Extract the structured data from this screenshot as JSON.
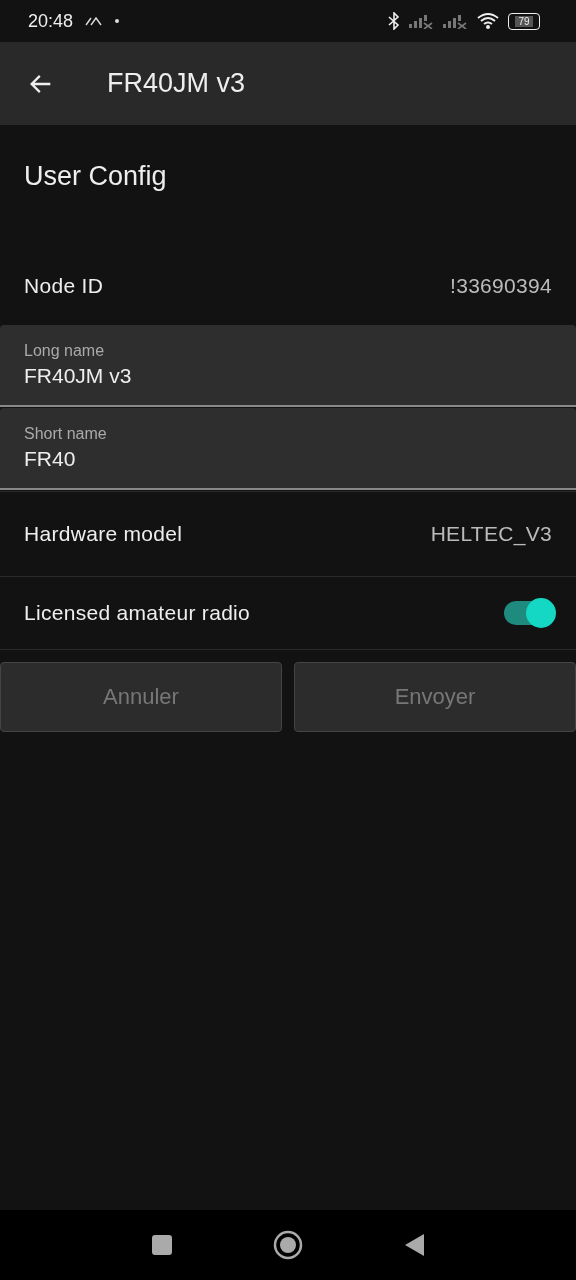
{
  "status_bar": {
    "time": "20:48",
    "battery": "79"
  },
  "app_bar": {
    "title": "FR40JM v3"
  },
  "section_title": "User Config",
  "node_id": {
    "label": "Node ID",
    "value": "!33690394"
  },
  "fields": [
    {
      "label": "Long name",
      "value": "FR40JM v3"
    },
    {
      "label": "Short name",
      "value": "FR40"
    }
  ],
  "hardware_model": {
    "label": "Hardware model",
    "value": "HELTEC_V3"
  },
  "licensed": {
    "label": "Licensed amateur radio",
    "on": true
  },
  "buttons": [
    {
      "label": "Annuler",
      "disabled": true
    },
    {
      "label": "Envoyer",
      "disabled": true
    }
  ]
}
